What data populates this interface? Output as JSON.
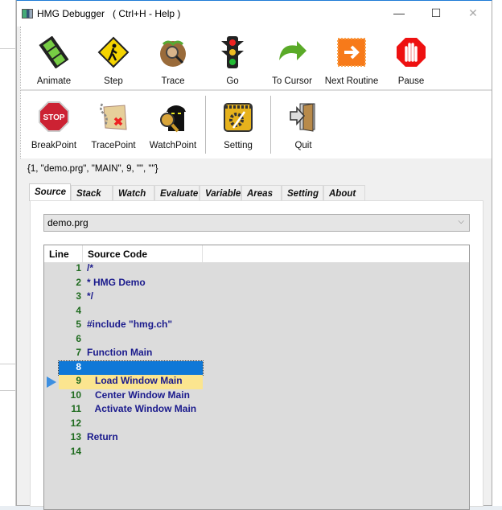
{
  "window": {
    "title": "HMG Debugger   ( Ctrl+H - Help )"
  },
  "toolbar_row1": [
    {
      "label": "Animate",
      "icon": "film-icon"
    },
    {
      "label": "Step",
      "icon": "pedestrian-sign-icon"
    },
    {
      "label": "Trace",
      "icon": "magnifier-ground-icon"
    },
    {
      "label": "Go",
      "icon": "traffic-light-icon"
    },
    {
      "label": "To Cursor",
      "icon": "curved-arrow-icon"
    },
    {
      "label": "Next Routine",
      "icon": "orange-arrow-icon"
    },
    {
      "label": "Pause",
      "icon": "stop-hand-icon"
    }
  ],
  "toolbar_row2": [
    {
      "label": "BreakPoint",
      "icon": "stop-sign-icon",
      "icon_text": "STOP"
    },
    {
      "label": "TracePoint",
      "icon": "map-icon"
    },
    {
      "label": "WatchPoint",
      "icon": "spy-icon"
    },
    {
      "label": "Setting",
      "icon": "tools-icon"
    },
    {
      "label": "Quit",
      "icon": "exit-door-icon"
    }
  ],
  "status": "{1, \"demo.prg\", \"MAIN\", 9, \"\", \"\"}",
  "tabs": [
    "Source",
    "Stack",
    "Watch",
    "Evaluate",
    "Variables",
    "Areas",
    "Setting",
    "About"
  ],
  "active_tab": "Source",
  "file_select": {
    "value": "demo.prg"
  },
  "grid": {
    "columns": [
      "Line",
      "Source Code"
    ],
    "rows": [
      {
        "line": "1",
        "code": "/*"
      },
      {
        "line": "2",
        "code": "* HMG Demo"
      },
      {
        "line": "3",
        "code": "*/"
      },
      {
        "line": "4",
        "code": ""
      },
      {
        "line": "5",
        "code": "#include \"hmg.ch\""
      },
      {
        "line": "6",
        "code": ""
      },
      {
        "line": "7",
        "code": "Function Main"
      },
      {
        "line": "8",
        "code": ""
      },
      {
        "line": "9",
        "code": "   Load Window Main"
      },
      {
        "line": "10",
        "code": "   Center Window Main"
      },
      {
        "line": "11",
        "code": "   Activate Window Main"
      },
      {
        "line": "12",
        "code": ""
      },
      {
        "line": "13",
        "code": "Return"
      },
      {
        "line": "14",
        "code": ""
      }
    ],
    "selected_line": "8",
    "current_line": "9"
  }
}
